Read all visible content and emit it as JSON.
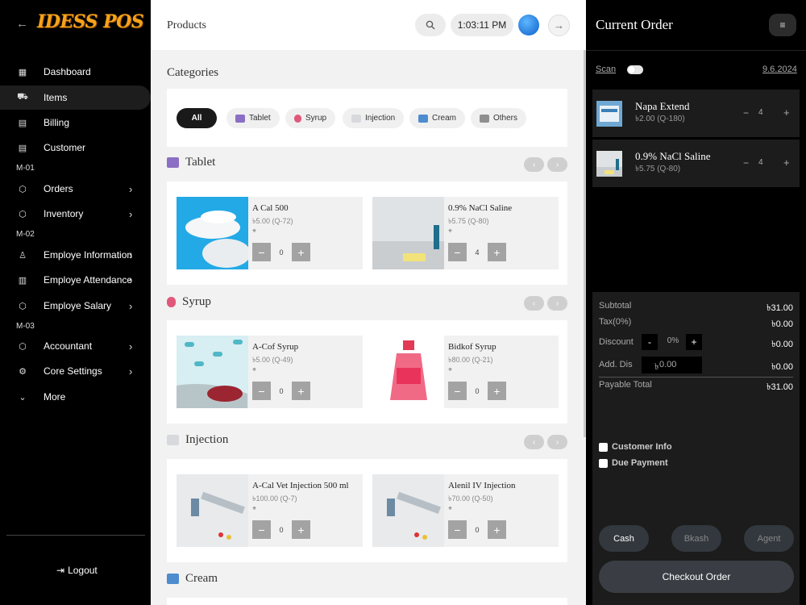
{
  "brand": {
    "name": "IDESS POS"
  },
  "sidebar": {
    "items": [
      {
        "label": "Dashboard",
        "icon": "dashboard-icon",
        "chevron": false
      },
      {
        "label": "Items",
        "icon": "cart-icon",
        "chevron": false,
        "active": true
      },
      {
        "label": "Billing",
        "icon": "billing-icon",
        "chevron": false
      },
      {
        "label": "Customer",
        "icon": "customer-icon",
        "chevron": false
      },
      {
        "label": "Orders",
        "icon": "box-icon",
        "chevron": true
      },
      {
        "label": "Inventory",
        "icon": "box-icon",
        "chevron": true
      },
      {
        "label": "Employe Information",
        "icon": "people-icon",
        "chevron": true
      },
      {
        "label": "Employe Attendance",
        "icon": "attendance-icon",
        "chevron": true
      },
      {
        "label": "Employe Salary",
        "icon": "box-icon",
        "chevron": true
      },
      {
        "label": "Accountant",
        "icon": "box-icon",
        "chevron": true
      },
      {
        "label": "Core Settings",
        "icon": "settings-icon",
        "chevron": true
      },
      {
        "label": "More",
        "icon": "chevron-down-icon",
        "chevron": false
      }
    ],
    "sections": [
      "M-01",
      "M-02",
      "M-03"
    ],
    "logout": "Logout"
  },
  "header": {
    "title": "Products",
    "time": "1:03:11 PM"
  },
  "categories": {
    "heading": "Categories",
    "chips": [
      {
        "label": "All",
        "active": true
      },
      {
        "label": "Tablet",
        "color": "#8a6fc4"
      },
      {
        "label": "Syrup",
        "color": "#e0587a"
      },
      {
        "label": "Injection",
        "color": "#9aa0a8"
      },
      {
        "label": "Cream",
        "color": "#4d8ccf"
      },
      {
        "label": "Others",
        "color": "#8f8f8f"
      }
    ]
  },
  "sections": [
    {
      "title": "Tablet",
      "products": [
        {
          "name": "A Cal 500",
          "price": "৳5.00 (Q-72)",
          "qty": "0"
        },
        {
          "name": "0.9% NaCl Saline",
          "price": "৳5.75 (Q-80)",
          "qty": "4"
        }
      ]
    },
    {
      "title": "Syrup",
      "products": [
        {
          "name": "A-Cof Syrup",
          "price": "৳5.00 (Q-49)",
          "qty": "0"
        },
        {
          "name": "Bidkof Syrup",
          "price": "৳80.00 (Q-21)",
          "qty": "0"
        }
      ]
    },
    {
      "title": "Injection",
      "products": [
        {
          "name": "A-Cal Vet Injection 500 ml",
          "price": "৳100.00 (Q-7)",
          "qty": "0"
        },
        {
          "name": "Alenil IV Injection",
          "price": "৳70.00 (Q-50)",
          "qty": "0"
        }
      ]
    },
    {
      "title": "Cream",
      "products": []
    }
  ],
  "order": {
    "title": "Current Order",
    "scan": "Scan",
    "date": "9.6.2024",
    "items": [
      {
        "name": "Napa Extend",
        "price": "৳2.00 (Q-180)",
        "qty": "4"
      },
      {
        "name": "0.9% NaCl Saline",
        "price": "৳5.75 (Q-80)",
        "qty": "4"
      }
    ],
    "summary": {
      "subtotal_label": "Subtotal",
      "subtotal": "৳31.00",
      "tax_label": "Tax(0%)",
      "tax": "৳0.00",
      "discount_label": "Discount",
      "discount_pct": "0%",
      "discount": "৳0.00",
      "adddis_label": "Add. Dis",
      "adddis_placeholder": "0.00",
      "adddis": "৳0.00",
      "payable_label": "Payable Total",
      "payable": "৳31.00"
    },
    "customer_info": "Customer Info",
    "due_payment": "Due Payment",
    "payment_methods": [
      "Cash",
      "Bkash",
      "Agent"
    ],
    "checkout": "Checkout Order"
  }
}
